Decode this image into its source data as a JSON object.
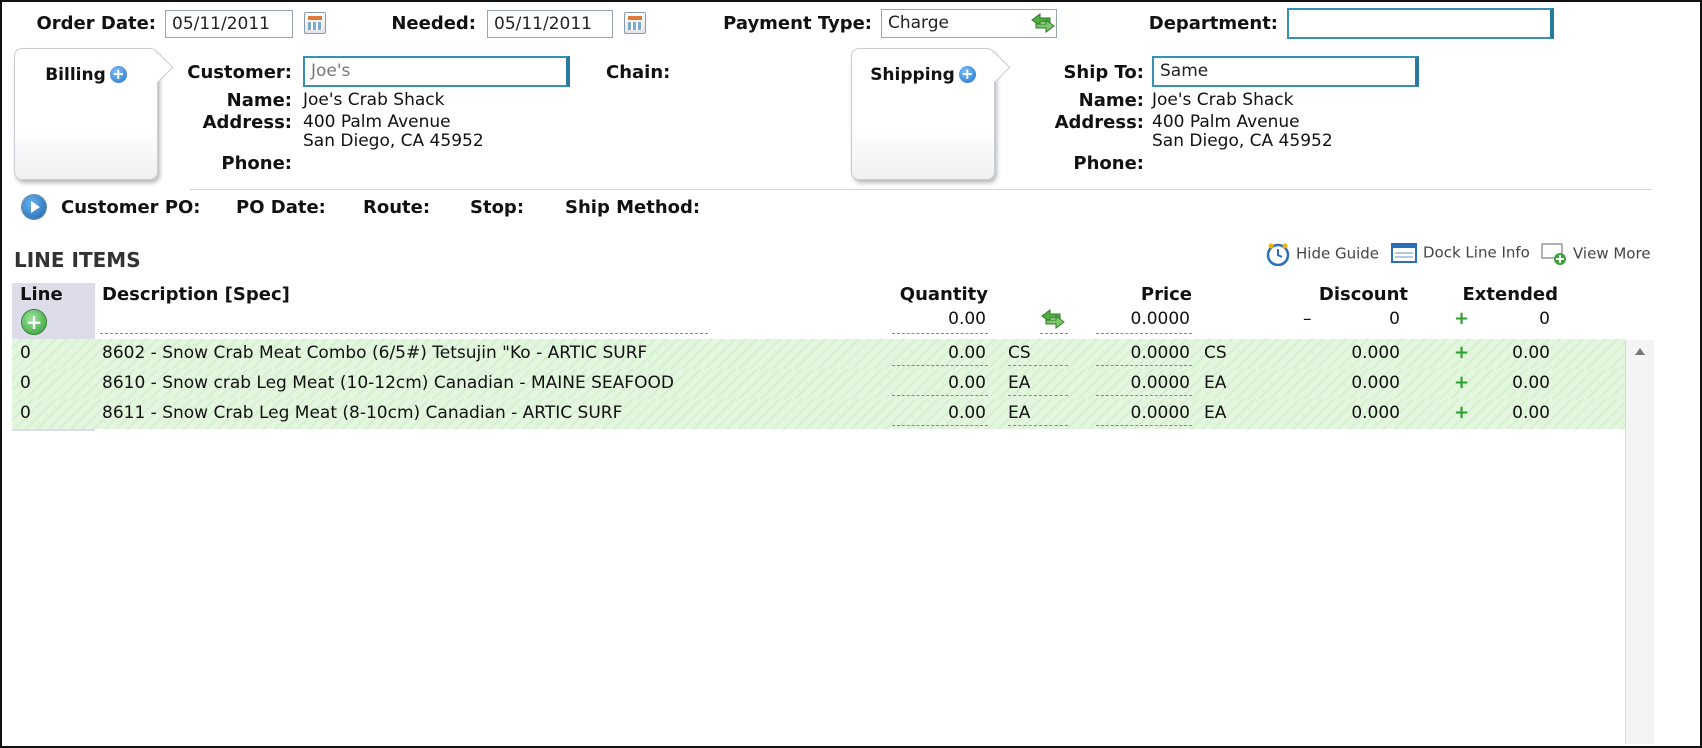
{
  "header": {
    "order_date_label": "Order Date:",
    "order_date_value": "05/11/2011",
    "needed_label": "Needed:",
    "needed_value": "05/11/2011",
    "payment_type_label": "Payment Type:",
    "payment_type_value": "Charge",
    "department_label": "Department:",
    "department_value": ""
  },
  "billing": {
    "title": "Billing",
    "customer_label": "Customer:",
    "customer_value": "Joe's",
    "chain_label": "Chain:",
    "name_label": "Name:",
    "name_value": "Joe's Crab Shack",
    "address_label": "Address:",
    "address_line1": "400 Palm Avenue",
    "address_line2": "San Diego, CA 45952",
    "phone_label": "Phone:"
  },
  "shipping": {
    "title": "Shipping",
    "ship_to_label": "Ship To:",
    "ship_to_value": "Same",
    "name_label": "Name:",
    "name_value": "Joe's Crab Shack",
    "address_label": "Address:",
    "address_line1": "400 Palm Avenue",
    "address_line2": "San Diego, CA 45952",
    "phone_label": "Phone:"
  },
  "order_info": {
    "customer_po_label": "Customer PO:",
    "po_date_label": "PO Date:",
    "route_label": "Route:",
    "stop_label": "Stop:",
    "ship_method_label": "Ship Method:"
  },
  "line_items": {
    "title": "LINE ITEMS",
    "toolbar": {
      "hide_guide": "Hide Guide",
      "dock_line_info": "Dock Line Info",
      "view_more": "View More"
    },
    "columns": {
      "line": "Line",
      "description": "Description [Spec]",
      "quantity": "Quantity",
      "price": "Price",
      "discount": "Discount",
      "extended": "Extended"
    },
    "new_row": {
      "quantity": "0.00",
      "price": "0.0000",
      "discount_sign": "–",
      "discount": "0",
      "extended": "0"
    },
    "rows": [
      {
        "line": "0",
        "description": "8602 - Snow Crab Meat Combo (6/5#) Tetsujin \"Ko - ARTIC SURF",
        "quantity": "0.00",
        "qty_unit": "CS",
        "price": "0.0000",
        "price_unit": "CS",
        "discount": "0.000",
        "extended": "0.00"
      },
      {
        "line": "0",
        "description": "8610 - Snow crab Leg Meat (10-12cm) Canadian - MAINE SEAFOOD",
        "quantity": "0.00",
        "qty_unit": "EA",
        "price": "0.0000",
        "price_unit": "EA",
        "discount": "0.000",
        "extended": "0.00"
      },
      {
        "line": "0",
        "description": "8611 - Snow Crab Leg Meat (8-10cm) Canadian - ARTIC SURF",
        "quantity": "0.00",
        "qty_unit": "EA",
        "price": "0.0000",
        "price_unit": "EA",
        "discount": "0.000",
        "extended": "0.00"
      }
    ]
  },
  "icons": {
    "calendar": "calendar-icon",
    "swap": "swap-arrows-icon",
    "add_blue": "plus-circle-icon",
    "expand": "play-circle-icon",
    "add_green": "add-line-icon",
    "plus": "plus-icon"
  },
  "colors": {
    "row_green": "#dff4da",
    "line_column": "#dcdde8",
    "focus_border": "#3a8fb5"
  }
}
